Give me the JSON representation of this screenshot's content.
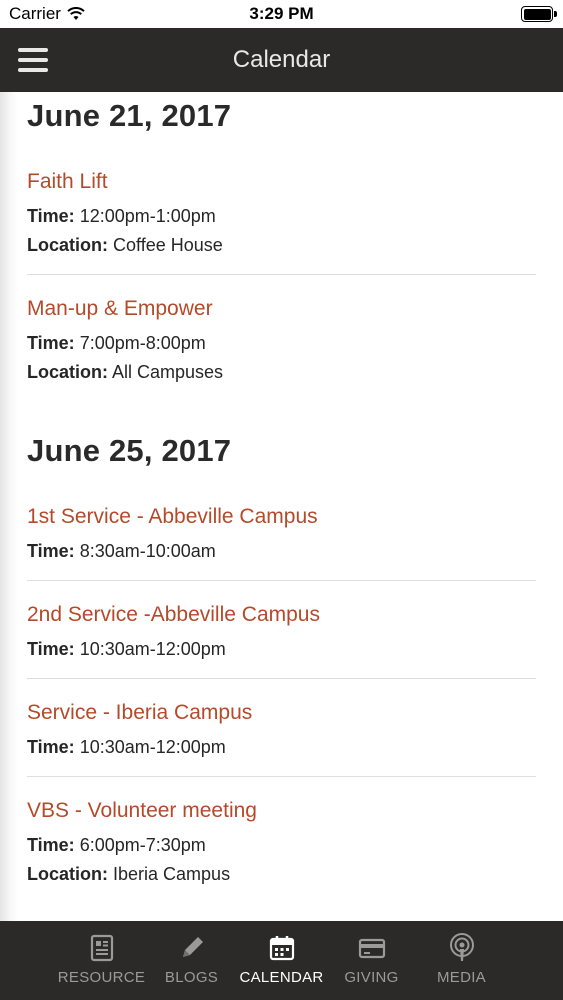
{
  "status": {
    "carrier": "Carrier",
    "time": "3:29 PM"
  },
  "header": {
    "title": "Calendar"
  },
  "days": [
    {
      "date": "June 21, 2017",
      "events": [
        {
          "name": "Faith Lift",
          "time_label": "Time:",
          "time": "12:00pm-1:00pm",
          "location_label": "Location:",
          "location": "Coffee House"
        },
        {
          "name": "Man-up & Empower",
          "time_label": "Time:",
          "time": "7:00pm-8:00pm",
          "location_label": "Location:",
          "location": "All Campuses"
        }
      ]
    },
    {
      "date": "June 25, 2017",
      "events": [
        {
          "name": "1st Service - Abbeville Campus",
          "time_label": "Time:",
          "time": "8:30am-10:00am"
        },
        {
          "name": "2nd Service -Abbeville Campus",
          "time_label": "Time:",
          "time": "10:30am-12:00pm"
        },
        {
          "name": "Service - Iberia Campus",
          "time_label": "Time:",
          "time": "10:30am-12:00pm"
        },
        {
          "name": "VBS - Volunteer meeting",
          "time_label": "Time:",
          "time": "6:00pm-7:30pm",
          "location_label": "Location:",
          "location": "Iberia Campus"
        }
      ]
    }
  ],
  "tabs": [
    {
      "label": "RESOURCE",
      "icon": "resource-icon"
    },
    {
      "label": "BLOGS",
      "icon": "pencil-icon"
    },
    {
      "label": "CALENDAR",
      "icon": "calendar-icon"
    },
    {
      "label": "GIVING",
      "icon": "credit-card-icon"
    },
    {
      "label": "MEDIA",
      "icon": "podcast-icon"
    }
  ],
  "colors": {
    "accent": "#b54a2a",
    "nav_bg": "#2b2a29",
    "active_tab": "#ffffff",
    "inactive_tab": "#9a9a9a"
  }
}
